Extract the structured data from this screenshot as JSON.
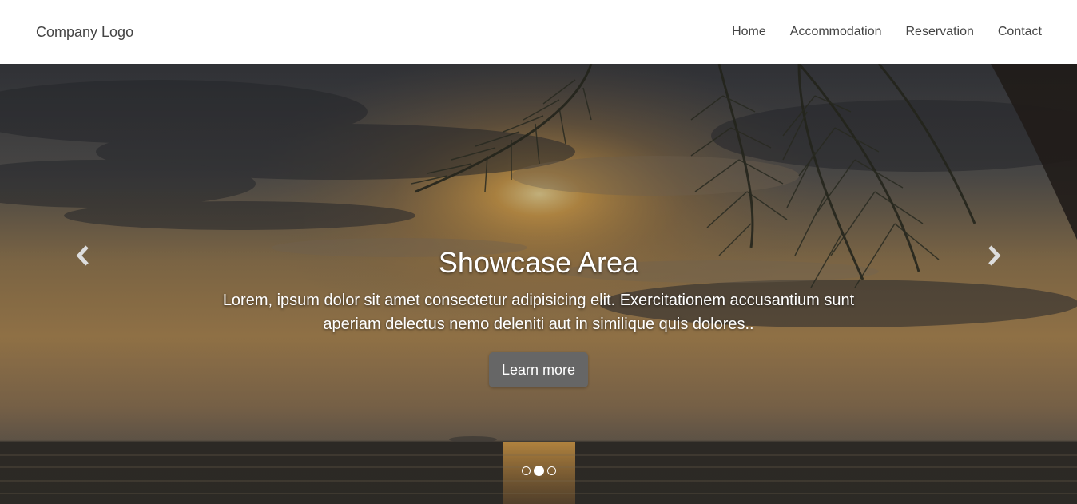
{
  "header": {
    "brand": "Company Logo",
    "nav": [
      "Home",
      "Accommodation",
      "Reservation",
      "Contact"
    ]
  },
  "showcase": {
    "title": "Showcase Area",
    "text": "Lorem, ipsum dolor sit amet consectetur adipisicing elit. Exercitationem accusantium sunt aperiam delectus nemo deleniti aut in similique quis dolores..",
    "button": "Learn more",
    "controls": {
      "prev_icon": "chevron-left-icon",
      "next_icon": "chevron-right-icon"
    },
    "slide_count": 3,
    "active_slide": 2
  },
  "colors": {
    "nav_text": "#444444",
    "button_bg": "#666666",
    "caption_text": "#ffffff"
  }
}
